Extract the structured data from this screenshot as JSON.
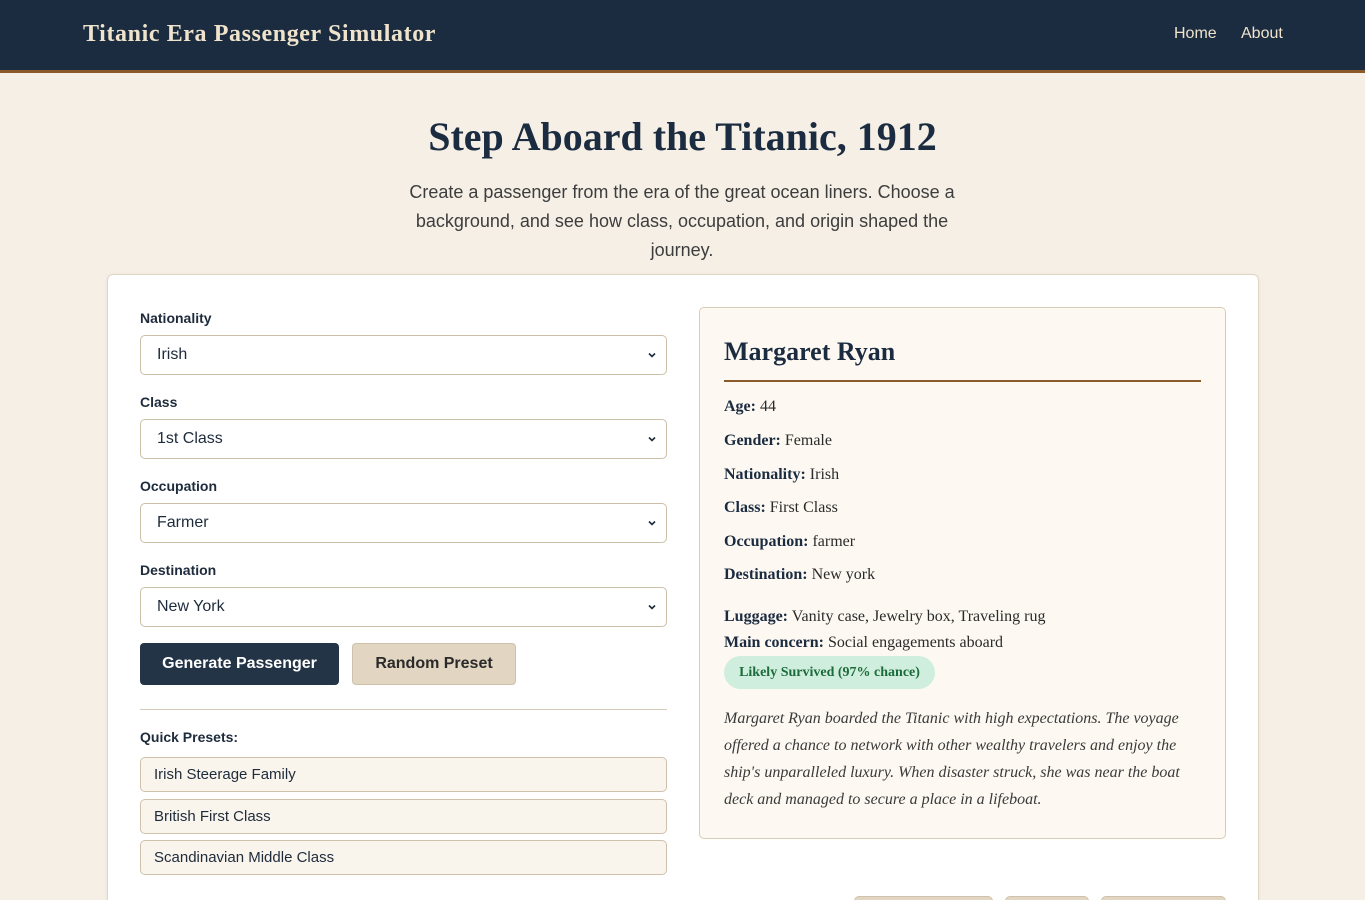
{
  "nav": {
    "brand": "Titanic Era Passenger Simulator",
    "links": [
      "Home",
      "About"
    ]
  },
  "hero": {
    "title": "Step Aboard the Titanic, 1912",
    "subtitle_line1": "Create a passenger from the era of the great ocean liners. Choose a",
    "subtitle_line2": "background, and see how class, occupation, and origin shaped the journey."
  },
  "form": {
    "nationality": {
      "label": "Nationality",
      "value": "Irish"
    },
    "class": {
      "label": "Class",
      "value": "1st Class"
    },
    "occupation": {
      "label": "Occupation",
      "value": "Farmer"
    },
    "destination": {
      "label": "Destination",
      "value": "New York"
    },
    "generate_label": "Generate Passenger",
    "random_label": "Random Preset",
    "presets_label": "Quick Presets:",
    "presets": [
      "Irish Steerage Family",
      "British First Class",
      "Scandinavian Middle Class"
    ]
  },
  "passenger": {
    "name": "Margaret Ryan",
    "age_label": "Age:",
    "age": "44",
    "gender_label": "Gender:",
    "gender": "Female",
    "nationality_label": "Nationality:",
    "nationality": "Irish",
    "class_label": "Class:",
    "class": "First Class",
    "occupation_label": "Occupation:",
    "occupation": "farmer",
    "destination_label": "Destination:",
    "destination": "New york",
    "luggage_label": "Luggage:",
    "luggage": "Vanity case, Jewelry box, Traveling rug",
    "concern_label": "Main concern:",
    "concern": "Social engagements aboard",
    "survival": "Likely Survived (97% chance)",
    "survival_color": "#1c6b3a",
    "story_lines": [
      "Margaret Ryan boarded the Titanic with high expectations. The voyage",
      "offered a chance to network with other wealthy travelers and enjoy the",
      "ship's unparalleled luxury. When disaster struck, she was near the boat",
      "deck and managed to secure a place in a lifeboat."
    ]
  },
  "colors": {
    "navbar": "#1b2b40",
    "accent": "#8a5a2b",
    "background": "#f5efe6",
    "primary_button": "#243447"
  }
}
